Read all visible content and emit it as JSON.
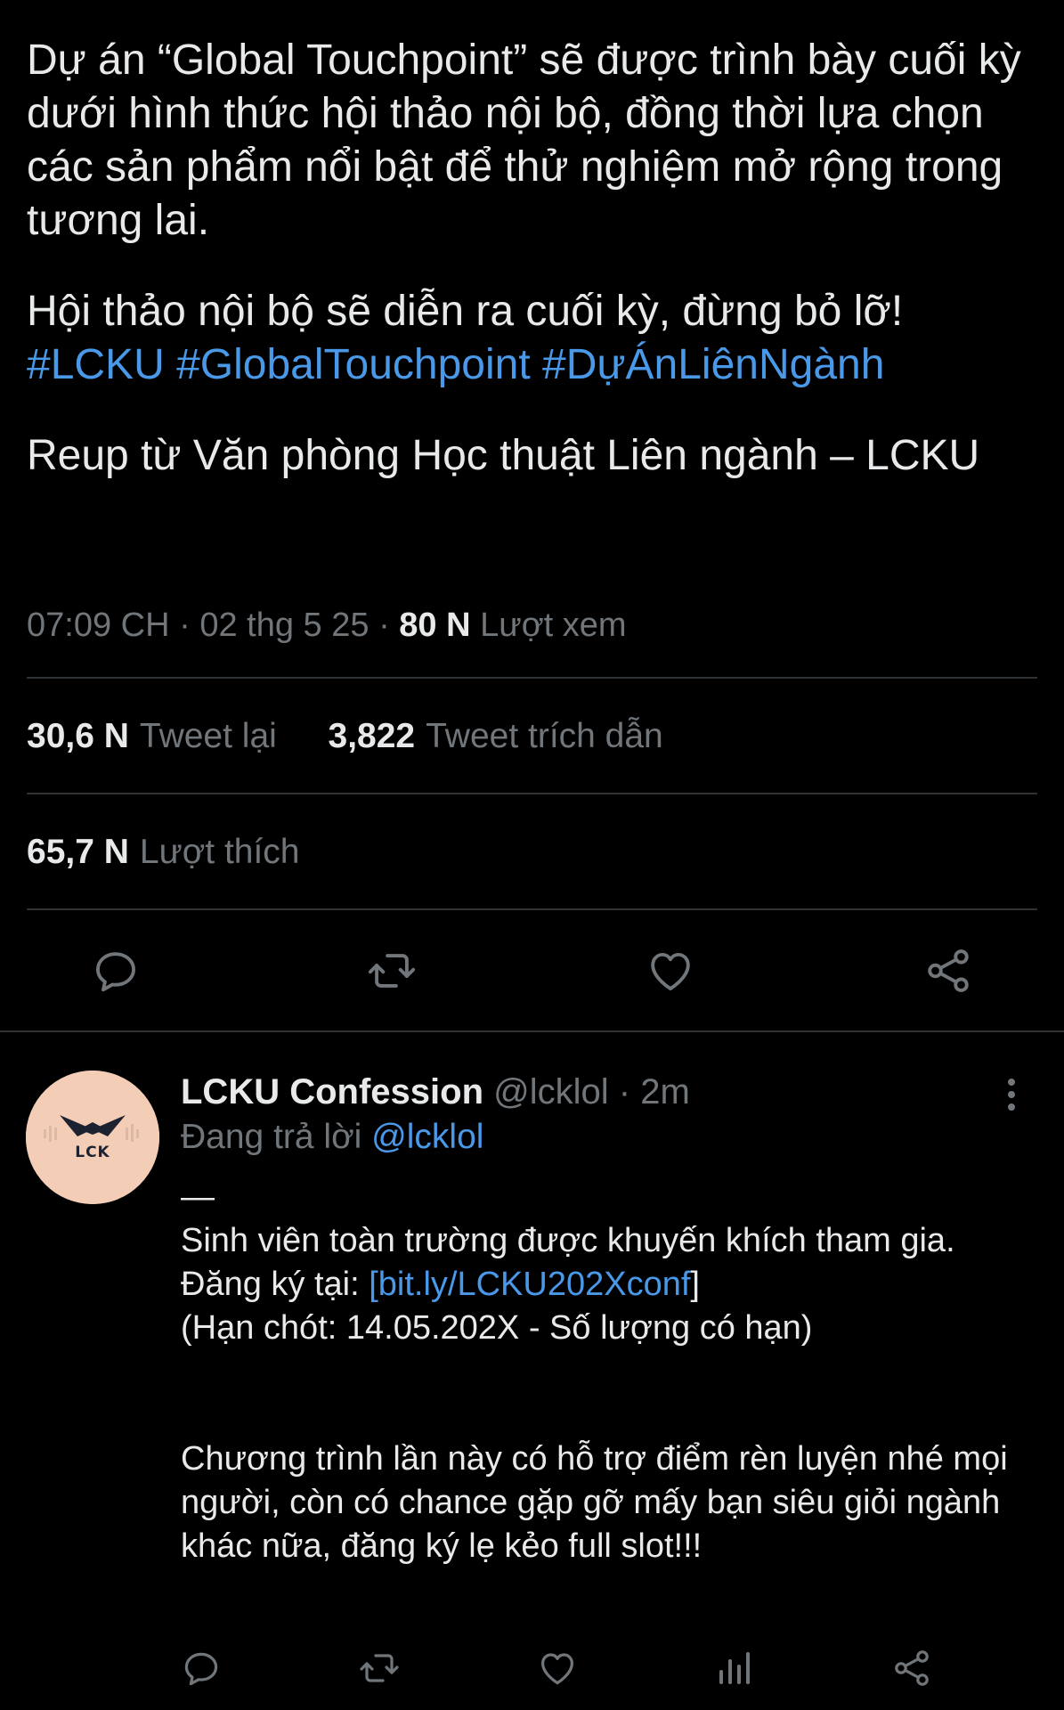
{
  "tweet": {
    "paragraph1": "Dự án “Global Touchpoint” sẽ được trình bày cuối kỳ dưới hình thức hội thảo nội bộ, đồng thời lựa chọn các sản phẩm nổi bật để thử nghiệm mở rộng trong tương lai.",
    "paragraph2": "Hội thảo nội bộ sẽ diễn ra cuối kỳ, đừng bỏ lỡ!",
    "hashtags": "#LCKU #GlobalTouchpoint #DựÁnLiênNgành",
    "paragraph3": "Reup từ Văn phòng Học thuật Liên ngành – LCKU",
    "time": "07:09 CH",
    "date": "02 thg 5 25",
    "separator": "·",
    "views_count": "80 N",
    "views_label": "Lượt xem"
  },
  "stats": {
    "retweets_count": "30,6 N",
    "retweets_label": "Tweet lại",
    "quotes_count": "3,822",
    "quotes_label": "Tweet trích dẫn",
    "likes_count": "65,7 N",
    "likes_label": "Lượt thích"
  },
  "icons": {
    "reply": "reply-icon",
    "retweet": "retweet-icon",
    "like": "heart-icon",
    "share": "share-icon",
    "views": "analytics-icon",
    "more": "more-vertical-icon"
  },
  "reply": {
    "display_name": "LCKU Confession",
    "handle": "@lcklol",
    "separator": "·",
    "time": "2m",
    "replying_prefix": "Đang trả lời",
    "replying_to": "@lcklol",
    "dash": "—",
    "line1": "Sinh viên toàn trường được khuyến khích tham gia.",
    "register_prefix": "Đăng ký tại: ",
    "register_link": "[bit.ly/LCKU202Xconf",
    "register_suffix": "]",
    "deadline": "(Hạn chót: 14.05.202X - Số lượng có hạn)",
    "closing": "Chương trình lần này có hỗ trợ điểm rèn luyện nhé mọi người, còn có chance gặp gỡ mấy bạn siêu giỏi ngành khác nữa, đăng ký lẹ kẻo full slot!!!",
    "avatar_logo_text": "LCK"
  },
  "colors": {
    "background": "#000000",
    "text_primary": "#e7e9ea",
    "text_secondary": "#71767b",
    "accent_link": "#4a99e9",
    "divider": "#2f3336",
    "avatar_bg": "#f3cdb6"
  }
}
